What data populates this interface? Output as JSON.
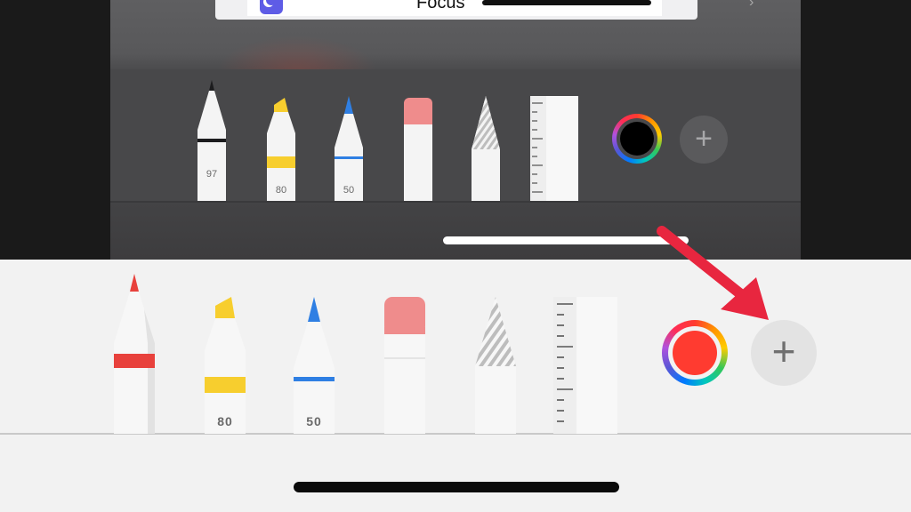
{
  "top_panel": {
    "focus_label": "Focus",
    "tools": [
      {
        "name": "pen",
        "label": "97",
        "color": "#1c1c1e"
      },
      {
        "name": "marker",
        "label": "80",
        "color": "#f7ce2e"
      },
      {
        "name": "pencil",
        "label": "50",
        "color": "#2f7fe3"
      },
      {
        "name": "eraser",
        "label": "",
        "color": "#ef8c8c"
      },
      {
        "name": "lasso",
        "label": "",
        "color": "#bdbdbd"
      },
      {
        "name": "ruler",
        "label": "",
        "color": "#ffffff"
      }
    ],
    "selected_color": "#000000",
    "add_symbol": "+"
  },
  "bottom_panel": {
    "tools": [
      {
        "name": "pen",
        "label": "",
        "color": "#e8413c"
      },
      {
        "name": "marker",
        "label": "80",
        "color": "#f7ce2e"
      },
      {
        "name": "pencil",
        "label": "50",
        "color": "#2f7fe3"
      },
      {
        "name": "eraser",
        "label": "",
        "color": "#ef8c8c"
      },
      {
        "name": "lasso",
        "label": "",
        "color": "#bdbdbd"
      },
      {
        "name": "ruler",
        "label": "",
        "color": "#ffffff"
      }
    ],
    "selected_color": "#ff3b30",
    "add_symbol": "+"
  },
  "annotation": {
    "icon": "red-arrow-icon",
    "color": "#e8263f"
  }
}
